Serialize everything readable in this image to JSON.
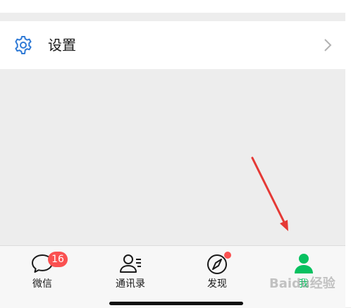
{
  "settings": {
    "label": "设置",
    "icon": "gear-icon",
    "chevron_icon": "chevron-right-icon"
  },
  "tabs": [
    {
      "label": "微信",
      "icon": "chat-bubble-icon",
      "badge": "16"
    },
    {
      "label": "通讯录",
      "icon": "contacts-icon"
    },
    {
      "label": "发现",
      "icon": "compass-icon",
      "dot": true
    },
    {
      "label": "我",
      "icon": "person-icon",
      "active": true
    }
  ],
  "watermark": {
    "text": "Baidu经验"
  },
  "colors": {
    "accent": "#07c160",
    "badge": "#fa5151",
    "arrow": "#e53935",
    "background": "#ededed"
  }
}
